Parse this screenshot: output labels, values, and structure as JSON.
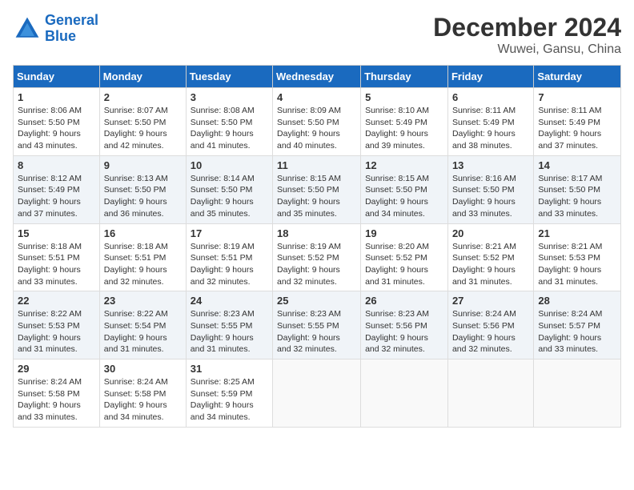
{
  "header": {
    "logo_line1": "General",
    "logo_line2": "Blue",
    "month_year": "December 2024",
    "location": "Wuwei, Gansu, China"
  },
  "weekdays": [
    "Sunday",
    "Monday",
    "Tuesday",
    "Wednesday",
    "Thursday",
    "Friday",
    "Saturday"
  ],
  "weeks": [
    [
      {
        "day": "1",
        "info": "Sunrise: 8:06 AM\nSunset: 5:50 PM\nDaylight: 9 hours\nand 43 minutes."
      },
      {
        "day": "2",
        "info": "Sunrise: 8:07 AM\nSunset: 5:50 PM\nDaylight: 9 hours\nand 42 minutes."
      },
      {
        "day": "3",
        "info": "Sunrise: 8:08 AM\nSunset: 5:50 PM\nDaylight: 9 hours\nand 41 minutes."
      },
      {
        "day": "4",
        "info": "Sunrise: 8:09 AM\nSunset: 5:50 PM\nDaylight: 9 hours\nand 40 minutes."
      },
      {
        "day": "5",
        "info": "Sunrise: 8:10 AM\nSunset: 5:49 PM\nDaylight: 9 hours\nand 39 minutes."
      },
      {
        "day": "6",
        "info": "Sunrise: 8:11 AM\nSunset: 5:49 PM\nDaylight: 9 hours\nand 38 minutes."
      },
      {
        "day": "7",
        "info": "Sunrise: 8:11 AM\nSunset: 5:49 PM\nDaylight: 9 hours\nand 37 minutes."
      }
    ],
    [
      {
        "day": "8",
        "info": "Sunrise: 8:12 AM\nSunset: 5:49 PM\nDaylight: 9 hours\nand 37 minutes."
      },
      {
        "day": "9",
        "info": "Sunrise: 8:13 AM\nSunset: 5:50 PM\nDaylight: 9 hours\nand 36 minutes."
      },
      {
        "day": "10",
        "info": "Sunrise: 8:14 AM\nSunset: 5:50 PM\nDaylight: 9 hours\nand 35 minutes."
      },
      {
        "day": "11",
        "info": "Sunrise: 8:15 AM\nSunset: 5:50 PM\nDaylight: 9 hours\nand 35 minutes."
      },
      {
        "day": "12",
        "info": "Sunrise: 8:15 AM\nSunset: 5:50 PM\nDaylight: 9 hours\nand 34 minutes."
      },
      {
        "day": "13",
        "info": "Sunrise: 8:16 AM\nSunset: 5:50 PM\nDaylight: 9 hours\nand 33 minutes."
      },
      {
        "day": "14",
        "info": "Sunrise: 8:17 AM\nSunset: 5:50 PM\nDaylight: 9 hours\nand 33 minutes."
      }
    ],
    [
      {
        "day": "15",
        "info": "Sunrise: 8:18 AM\nSunset: 5:51 PM\nDaylight: 9 hours\nand 33 minutes."
      },
      {
        "day": "16",
        "info": "Sunrise: 8:18 AM\nSunset: 5:51 PM\nDaylight: 9 hours\nand 32 minutes."
      },
      {
        "day": "17",
        "info": "Sunrise: 8:19 AM\nSunset: 5:51 PM\nDaylight: 9 hours\nand 32 minutes."
      },
      {
        "day": "18",
        "info": "Sunrise: 8:19 AM\nSunset: 5:52 PM\nDaylight: 9 hours\nand 32 minutes."
      },
      {
        "day": "19",
        "info": "Sunrise: 8:20 AM\nSunset: 5:52 PM\nDaylight: 9 hours\nand 31 minutes."
      },
      {
        "day": "20",
        "info": "Sunrise: 8:21 AM\nSunset: 5:52 PM\nDaylight: 9 hours\nand 31 minutes."
      },
      {
        "day": "21",
        "info": "Sunrise: 8:21 AM\nSunset: 5:53 PM\nDaylight: 9 hours\nand 31 minutes."
      }
    ],
    [
      {
        "day": "22",
        "info": "Sunrise: 8:22 AM\nSunset: 5:53 PM\nDaylight: 9 hours\nand 31 minutes."
      },
      {
        "day": "23",
        "info": "Sunrise: 8:22 AM\nSunset: 5:54 PM\nDaylight: 9 hours\nand 31 minutes."
      },
      {
        "day": "24",
        "info": "Sunrise: 8:23 AM\nSunset: 5:55 PM\nDaylight: 9 hours\nand 31 minutes."
      },
      {
        "day": "25",
        "info": "Sunrise: 8:23 AM\nSunset: 5:55 PM\nDaylight: 9 hours\nand 32 minutes."
      },
      {
        "day": "26",
        "info": "Sunrise: 8:23 AM\nSunset: 5:56 PM\nDaylight: 9 hours\nand 32 minutes."
      },
      {
        "day": "27",
        "info": "Sunrise: 8:24 AM\nSunset: 5:56 PM\nDaylight: 9 hours\nand 32 minutes."
      },
      {
        "day": "28",
        "info": "Sunrise: 8:24 AM\nSunset: 5:57 PM\nDaylight: 9 hours\nand 33 minutes."
      }
    ],
    [
      {
        "day": "29",
        "info": "Sunrise: 8:24 AM\nSunset: 5:58 PM\nDaylight: 9 hours\nand 33 minutes."
      },
      {
        "day": "30",
        "info": "Sunrise: 8:24 AM\nSunset: 5:58 PM\nDaylight: 9 hours\nand 34 minutes."
      },
      {
        "day": "31",
        "info": "Sunrise: 8:25 AM\nSunset: 5:59 PM\nDaylight: 9 hours\nand 34 minutes."
      },
      {
        "day": "",
        "info": ""
      },
      {
        "day": "",
        "info": ""
      },
      {
        "day": "",
        "info": ""
      },
      {
        "day": "",
        "info": ""
      }
    ]
  ]
}
